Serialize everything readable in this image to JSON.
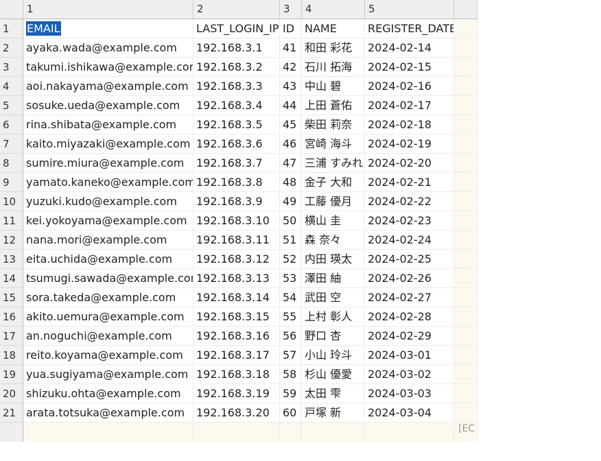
{
  "col_headers": [
    "1",
    "2",
    "3",
    "4",
    "5"
  ],
  "field_names": [
    "EMAIL",
    "LAST_LOGIN_IP",
    "ID",
    "NAME",
    "REGISTER_DATE"
  ],
  "rows": [
    [
      "ayaka.wada@example.com",
      "192.168.3.1",
      "41",
      "和田 彩花",
      "2024-02-14"
    ],
    [
      "takumi.ishikawa@example.com",
      "192.168.3.2",
      "42",
      "石川 拓海",
      "2024-02-15"
    ],
    [
      "aoi.nakayama@example.com",
      "192.168.3.3",
      "43",
      "中山 碧",
      "2024-02-16"
    ],
    [
      "sosuke.ueda@example.com",
      "192.168.3.4",
      "44",
      "上田 蒼佑",
      "2024-02-17"
    ],
    [
      "rina.shibata@example.com",
      "192.168.3.5",
      "45",
      "柴田 莉奈",
      "2024-02-18"
    ],
    [
      "kaito.miyazaki@example.com",
      "192.168.3.6",
      "46",
      "宮崎 海斗",
      "2024-02-19"
    ],
    [
      "sumire.miura@example.com",
      "192.168.3.7",
      "47",
      "三浦 すみれ",
      "2024-02-20"
    ],
    [
      "yamato.kaneko@example.com",
      "192.168.3.8",
      "48",
      "金子 大和",
      "2024-02-21"
    ],
    [
      "yuzuki.kudo@example.com",
      "192.168.3.9",
      "49",
      "工藤 優月",
      "2024-02-22"
    ],
    [
      "kei.yokoyama@example.com",
      "192.168.3.10",
      "50",
      "横山 圭",
      "2024-02-23"
    ],
    [
      "nana.mori@example.com",
      "192.168.3.11",
      "51",
      "森 奈々",
      "2024-02-24"
    ],
    [
      "eita.uchida@example.com",
      "192.168.3.12",
      "52",
      "内田 瑛太",
      "2024-02-25"
    ],
    [
      "tsumugi.sawada@example.com",
      "192.168.3.13",
      "53",
      "澤田 紬",
      "2024-02-26"
    ],
    [
      "sora.takeda@example.com",
      "192.168.3.14",
      "54",
      "武田 空",
      "2024-02-27"
    ],
    [
      "akito.uemura@example.com",
      "192.168.3.15",
      "55",
      "上村 彰人",
      "2024-02-28"
    ],
    [
      "an.noguchi@example.com",
      "192.168.3.16",
      "56",
      "野口 杏",
      "2024-02-29"
    ],
    [
      "reito.koyama@example.com",
      "192.168.3.17",
      "57",
      "小山 玲斗",
      "2024-03-01"
    ],
    [
      "yua.sugiyama@example.com",
      "192.168.3.18",
      "58",
      "杉山 優愛",
      "2024-03-02"
    ],
    [
      "shizuku.ohta@example.com",
      "192.168.3.19",
      "59",
      "太田 雫",
      "2024-03-03"
    ],
    [
      "arata.totsuka@example.com",
      "192.168.3.20",
      "60",
      "戸塚 新",
      "2024-03-04"
    ]
  ],
  "row_numbers": [
    "1",
    "2",
    "3",
    "4",
    "5",
    "6",
    "7",
    "8",
    "9",
    "10",
    "11",
    "12",
    "13",
    "14",
    "15",
    "16",
    "17",
    "18",
    "19",
    "20",
    "21"
  ],
  "status_fragment": "[EC",
  "selected_cell": "EMAIL"
}
